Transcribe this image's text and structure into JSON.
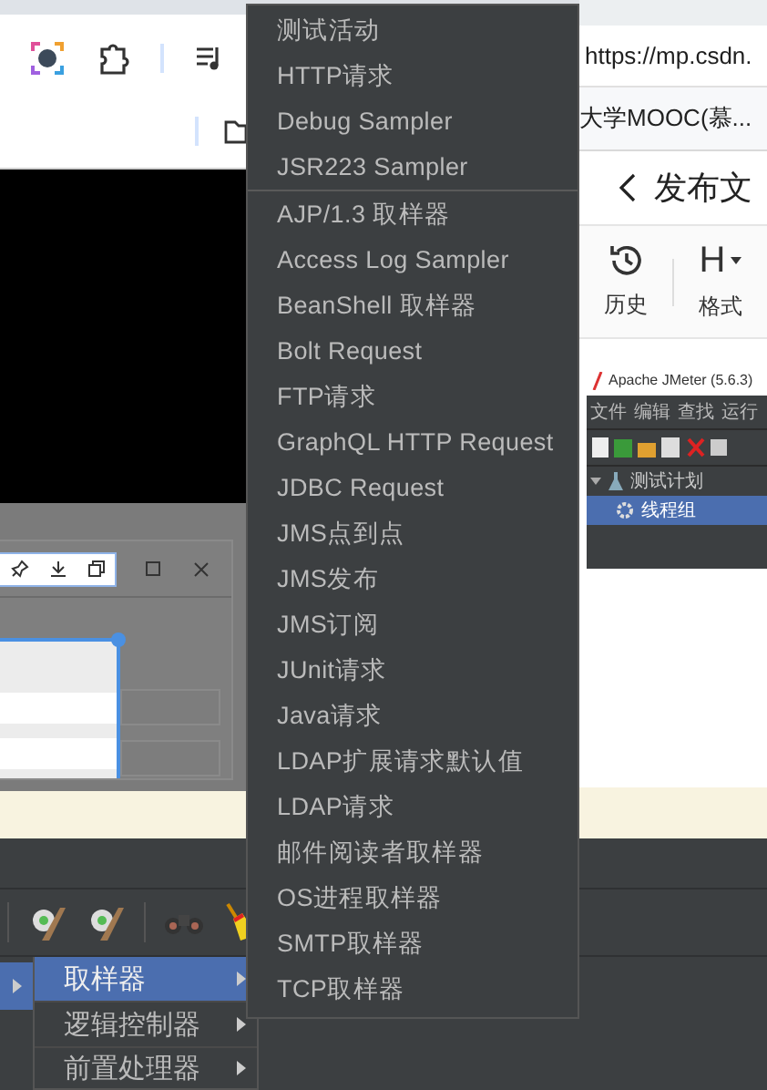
{
  "browser": {
    "address": "https://mp.csdn.",
    "bookmark": "大学MOOC(慕..."
  },
  "editor": {
    "title": "发布文",
    "tools": [
      {
        "kind": "icon",
        "label": "历史"
      },
      {
        "kind": "glyph",
        "glyph": "H",
        "label": "格式"
      }
    ]
  },
  "jmeter_preview": {
    "title": "Apache JMeter (5.6.3)",
    "menus": [
      "文件",
      "编辑",
      "查找",
      "运行"
    ],
    "tree": [
      {
        "label": "测试计划",
        "expanded": true,
        "selected": false,
        "children": [
          {
            "label": "线程组",
            "selected": true
          }
        ]
      }
    ]
  },
  "sampler_menu": {
    "groups": [
      [
        "测试活动",
        "HTTP请求",
        "Debug Sampler",
        "JSR223 Sampler"
      ],
      [
        "AJP/1.3 取样器",
        "Access Log Sampler",
        "BeanShell 取样器",
        "Bolt Request",
        "FTP请求",
        "GraphQL HTTP Request",
        "JDBC Request",
        "JMS点到点",
        "JMS发布",
        "JMS订阅",
        "JUnit请求",
        "Java请求",
        "LDAP扩展请求默认值",
        "LDAP请求",
        "邮件阅读者取样器",
        "OS进程取样器",
        "SMTP取样器",
        "TCP取样器"
      ]
    ]
  },
  "context_menu": {
    "parent_item": {
      "selected": true
    },
    "items": [
      {
        "label": "取样器",
        "selected": true,
        "has_submenu": true
      },
      {
        "label": "逻辑控制器",
        "selected": false,
        "has_submenu": true
      },
      {
        "label": "前置处理器",
        "selected": false,
        "has_submenu": true
      }
    ]
  }
}
